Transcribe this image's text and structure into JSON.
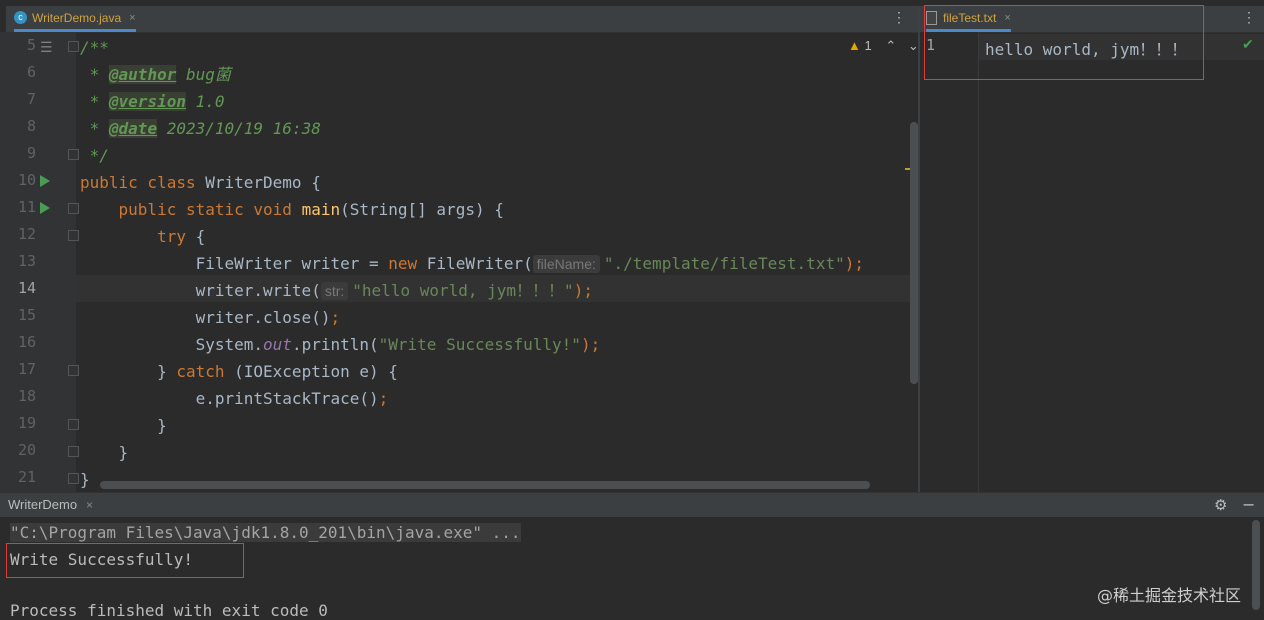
{
  "tabs": {
    "left": {
      "label": "WriterDemo.java",
      "close": "×"
    },
    "right": {
      "label": "fileTest.txt",
      "close": "×"
    },
    "more": "⋮"
  },
  "inspection": {
    "count": "1"
  },
  "gutter": {
    "line_numbers": [
      "5",
      "6",
      "7",
      "8",
      "9",
      "10",
      "11",
      "12",
      "13",
      "14",
      "15",
      "16",
      "17",
      "18",
      "19",
      "20",
      "21"
    ]
  },
  "code": {
    "l5": "/**",
    "l6_star": " * ",
    "l6_tag": "@author",
    "l6_text": " bug菌",
    "l7_tag": "@version",
    "l7_text": " 1.0",
    "l8_tag": "@date",
    "l8_text": " 2023/10/19 16:38",
    "l9": " */",
    "l10_kw": "public class",
    "l10_rest": " WriterDemo {",
    "l11_kw": "public static void",
    "l11_fn": "main",
    "l11_rest": "(String[] args) {",
    "l12_kw": "try",
    "l12_rest": " {",
    "l13_a": "FileWriter writer = ",
    "l13_kw": "new",
    "l13_b": " FileWriter(",
    "l13_hint": "fileName:",
    "l13_str": "\"./template/fileTest.txt\"",
    "l13_end": ");",
    "l14_a": "writer.write(",
    "l14_hint": "str:",
    "l14_str": "\"hello world, jym！！！\"",
    "l14_end": ");",
    "l15_a": "writer.close()",
    "l15_end": ";",
    "l16_a": "System.",
    "l16_out": "out",
    "l16_b": ".println(",
    "l16_str": "\"Write Successfully!\"",
    "l16_end": ");",
    "l17_a": "} ",
    "l17_kw": "catch",
    "l17_b": " (IOException e) {",
    "l18_a": "e.printStackTrace()",
    "l18_end": ";",
    "l19": "}",
    "l20": "}",
    "l21": "}"
  },
  "right_editor": {
    "line_number": "1",
    "content": "hello world, jym！！！"
  },
  "run_panel": {
    "tab": "WriterDemo",
    "close": "×",
    "command": "\"C:\\Program Files\\Java\\jdk1.8.0_201\\bin\\java.exe\" ...",
    "output": "Write Successfully!",
    "exit_partial": "Process finished with exit code 0"
  },
  "watermark": "@稀土掘金技术社区",
  "colors": {
    "keyword": "#cc7832",
    "string": "#6a8759",
    "comment": "#629755",
    "function": "#ffc66d",
    "highlight_box": "#e03c3c"
  }
}
